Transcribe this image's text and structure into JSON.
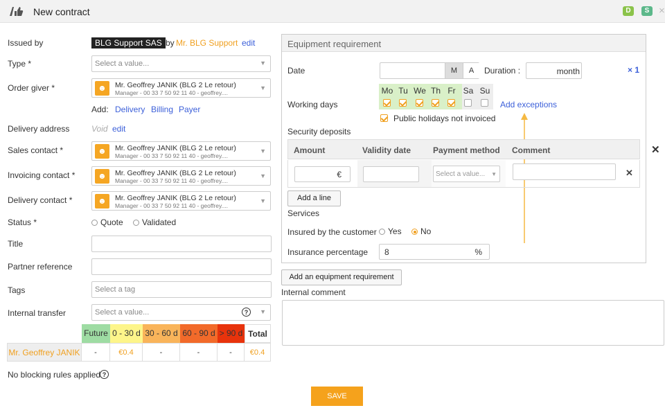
{
  "header": {
    "title": "New contract",
    "badge_d": "D",
    "badge_s": "S",
    "close": "×",
    "colors": {
      "badge_d": "#8bc34a",
      "badge_s": "#5cb88a"
    }
  },
  "form": {
    "issued_by": {
      "label": "Issued by",
      "company": "BLG Support SAS",
      "by": "by",
      "person": "Mr. BLG Support",
      "edit": "edit"
    },
    "type": {
      "label": "Type *",
      "placeholder": "Select a value..."
    },
    "order_giver": {
      "label": "Order giver *",
      "name": "Mr. Geoffrey JANIK (BLG 2 Le retour)",
      "detail": "Manager - 00 33 7 50 92 11 40 - geoffrey...."
    },
    "add": {
      "label": "Add:",
      "delivery": "Delivery",
      "billing": "Billing",
      "payer": "Payer"
    },
    "delivery_address": {
      "label": "Delivery address",
      "value": "Void",
      "edit": "edit"
    },
    "sales_contact": {
      "label": "Sales contact *",
      "name": "Mr. Geoffrey JANIK (BLG 2 Le retour)",
      "detail": "Manager - 00 33 7 50 92 11 40 - geoffrey...."
    },
    "invoicing_contact": {
      "label": "Invoicing contact *",
      "name": "Mr. Geoffrey JANIK (BLG 2 Le retour)",
      "detail": "Manager - 00 33 7 50 92 11 40 - geoffrey...."
    },
    "delivery_contact": {
      "label": "Delivery contact *",
      "name": "Mr. Geoffrey JANIK (BLG 2 Le retour)",
      "detail": "Manager - 00 33 7 50 92 11 40 - geoffrey...."
    },
    "status": {
      "label": "Status *",
      "quote": "Quote",
      "validated": "Validated"
    },
    "title": {
      "label": "Title"
    },
    "partner_reference": {
      "label": "Partner reference"
    },
    "tags": {
      "label": "Tags",
      "placeholder": "Select a tag"
    },
    "internal_transfer": {
      "label": "Internal transfer",
      "placeholder": "Select a value..."
    }
  },
  "aging": {
    "headers": [
      "Future",
      "0 - 30 d",
      "30 - 60 d",
      "60 - 90 d",
      "> 90 d",
      "Total"
    ],
    "header_colors": [
      "#9edca3",
      "#fdf58a",
      "#f9b45a",
      "#f26a2a",
      "#e8330c",
      "#ffffff"
    ],
    "row_name": "Mr. Geoffrey JANIK",
    "values": [
      "-",
      "€0.4",
      "-",
      "-",
      "-",
      "€0.4"
    ]
  },
  "blocking": "No blocking rules applied",
  "save": "SAVE",
  "equipment": {
    "title": "Equipment requirement",
    "date_label": "Date",
    "m": "M",
    "a": "A",
    "duration_label": "Duration :",
    "duration_unit": "month",
    "multiplier": "× 1",
    "working_days_label": "Working days",
    "days": [
      "Mo",
      "Tu",
      "We",
      "Th",
      "Fr",
      "Sa",
      "Su"
    ],
    "days_checked": [
      true,
      true,
      true,
      true,
      true,
      false,
      false
    ],
    "add_exceptions": "Add exceptions",
    "public_holidays": "Public holidays not invoiced",
    "security_deposits": "Security deposits",
    "deposit_columns": [
      "Amount",
      "Validity date",
      "Payment method",
      "Comment"
    ],
    "currency": "€",
    "payment_placeholder": "Select a value...",
    "add_line": "Add a line",
    "services": "Services",
    "insured_label": "Insured by the customer",
    "yes": "Yes",
    "no": "No",
    "insurance_pct_label": "Insurance percentage",
    "insurance_pct_value": "8",
    "pct": "%",
    "remove_icon": "✕"
  },
  "add_equipment": "Add an equipment requirement",
  "internal_comment": "Internal comment",
  "accent": "#f0a020",
  "link_color": "#3b5fd9"
}
